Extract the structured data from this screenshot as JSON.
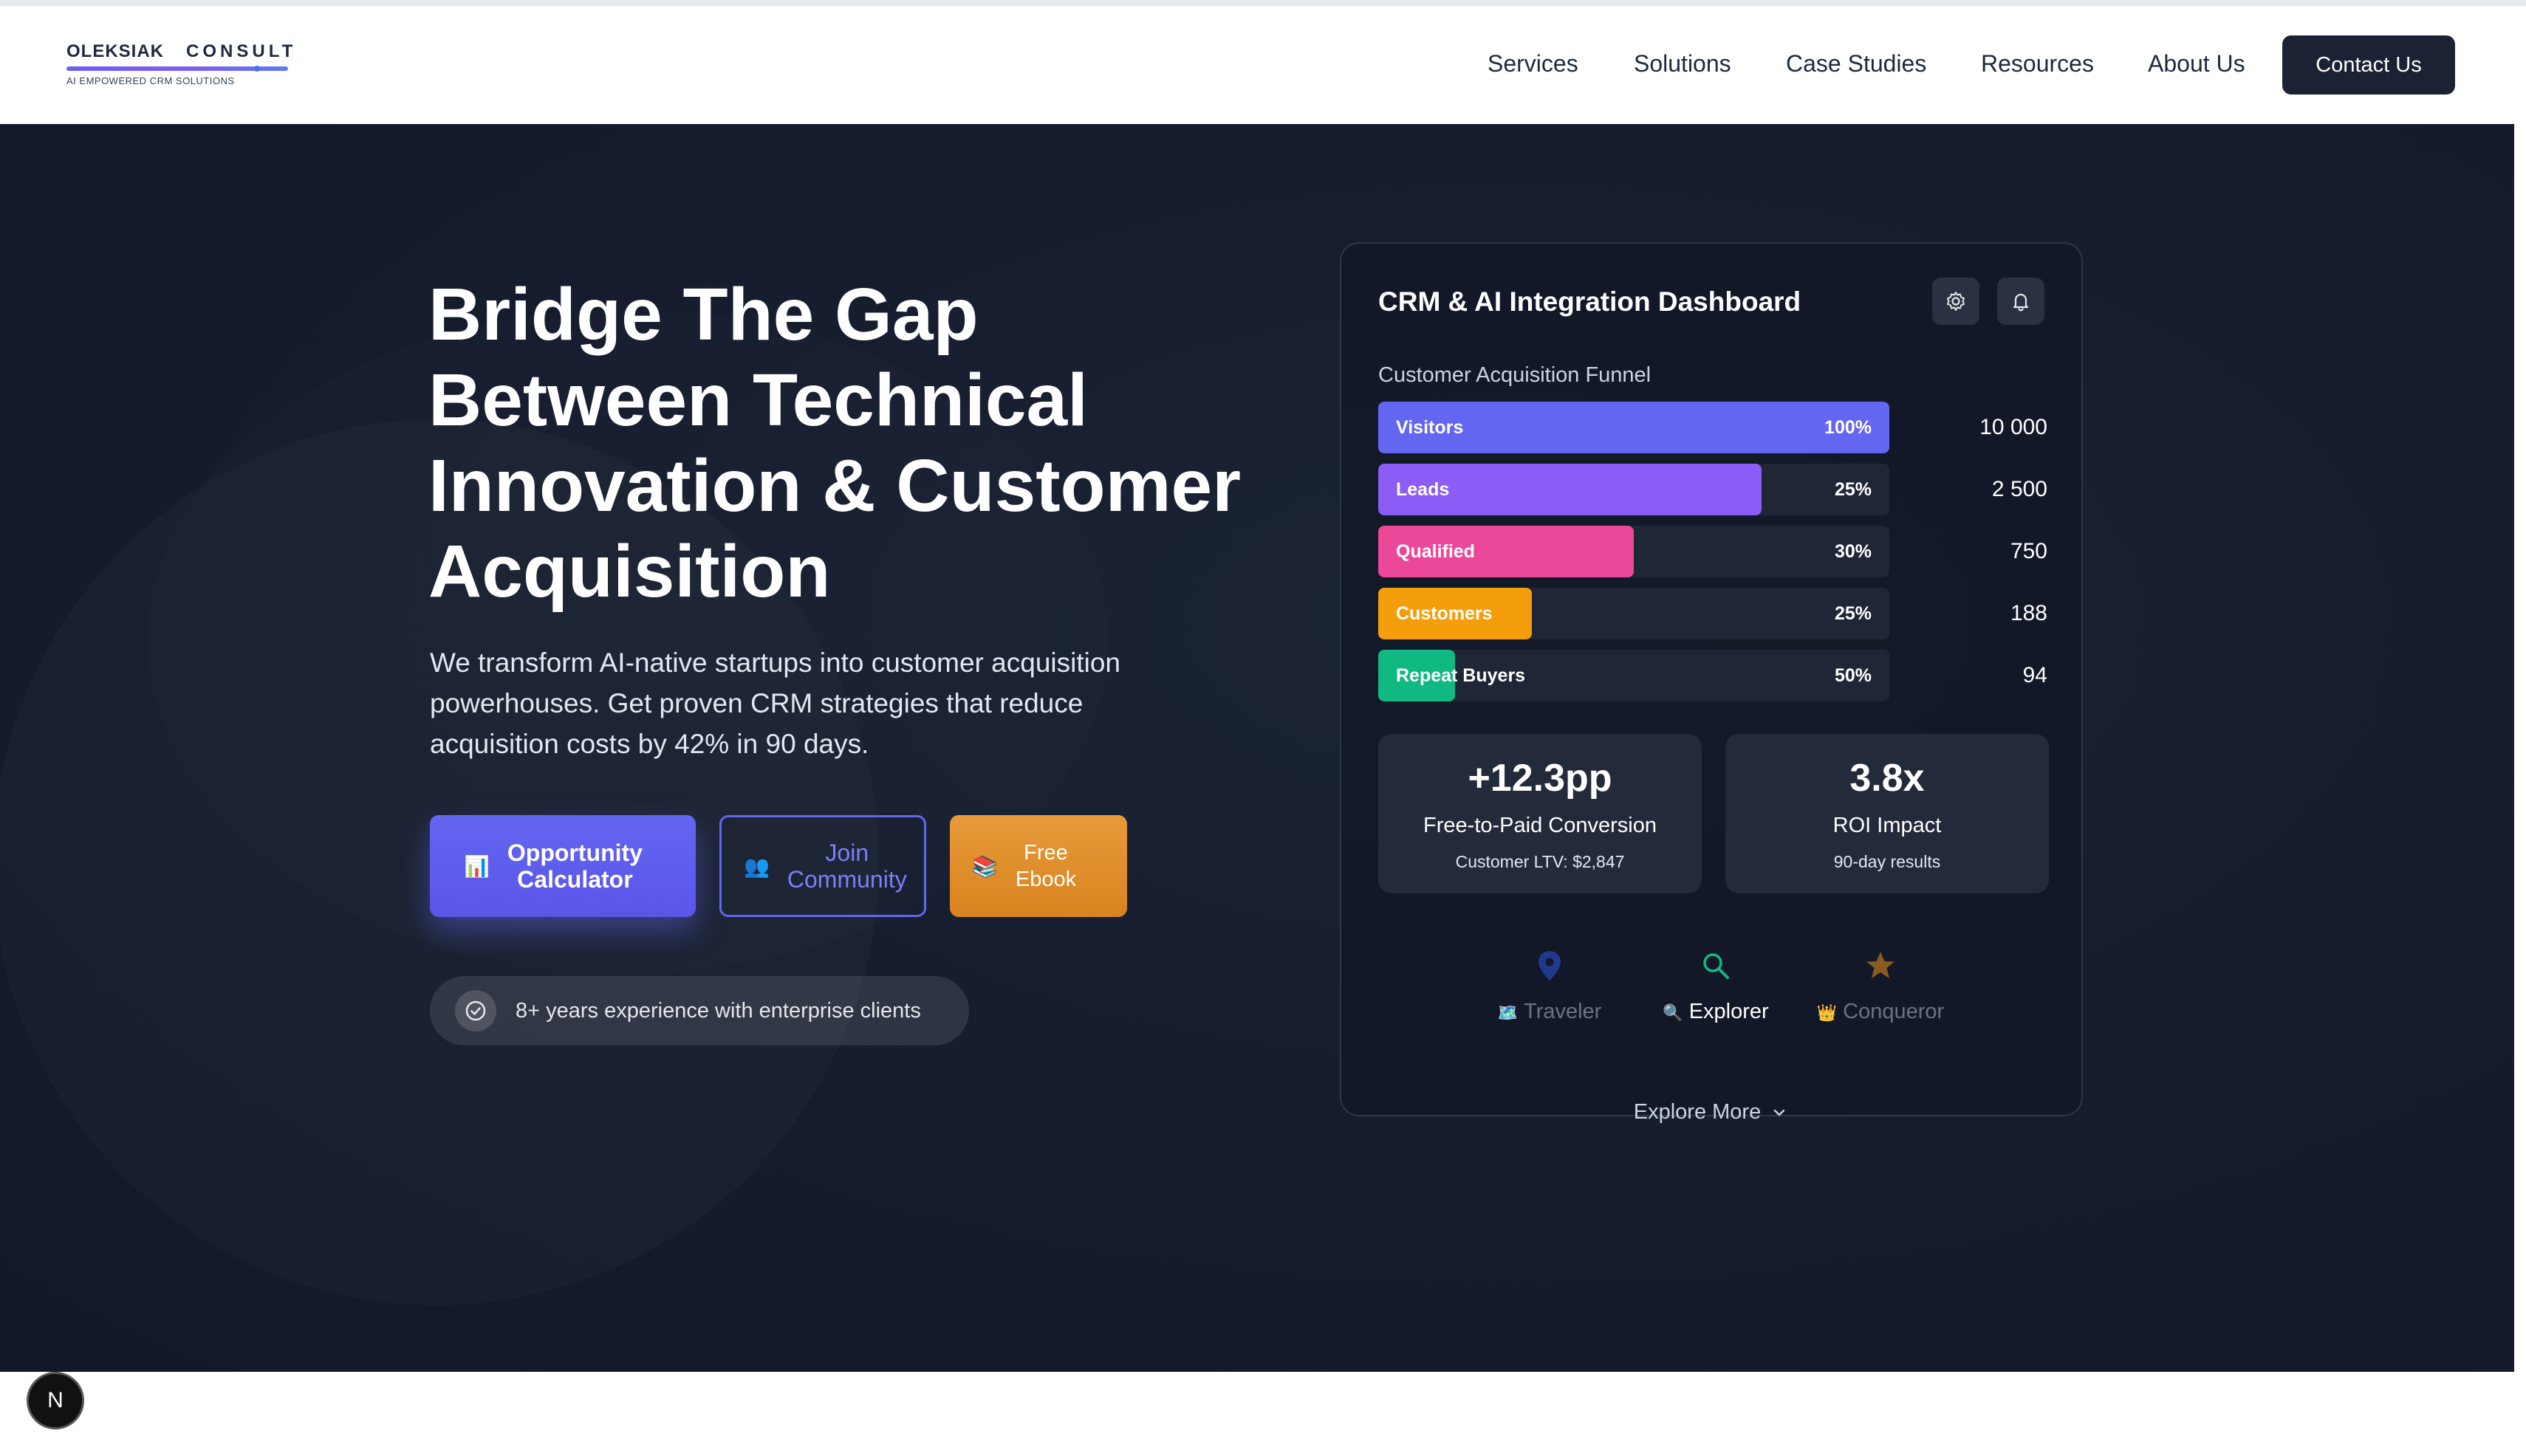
{
  "brand": {
    "name_part1": "OLEKSIAK",
    "name_part2": "CONSULT",
    "tagline": "AI EMPOWERED CRM SOLUTIONS"
  },
  "nav": {
    "items": [
      "Services",
      "Solutions",
      "Case Studies",
      "Resources",
      "About Us"
    ],
    "cta": "Contact Us"
  },
  "hero": {
    "headline_lines": [
      "Bridge The Gap",
      "Between Technical",
      "Innovation & Customer",
      "Acquisition"
    ],
    "subtext": "We transform AI-native startups into customer acquisition powerhouses. Get proven CRM strategies that reduce acquisition costs by 42% in 90 days.",
    "buttons": {
      "calculator": {
        "icon": "📊",
        "line1": "Opportunity",
        "line2": "Calculator"
      },
      "community": {
        "icon": "👥",
        "line1": "Join",
        "line2": "Community"
      },
      "ebook": {
        "icon": "📚",
        "line1": "Free",
        "line2": "Ebook"
      }
    },
    "experience": "8+ years experience with enterprise clients"
  },
  "dashboard": {
    "title": "CRM & AI Integration Dashboard",
    "icons": [
      "gear-icon",
      "bell-icon"
    ],
    "funnel": {
      "label": "Customer Acquisition Funnel",
      "rows": [
        {
          "name": "Visitors",
          "pct": "100%",
          "value": "10 000",
          "fill": 1.0,
          "color": "#6366f1"
        },
        {
          "name": "Leads",
          "pct": "25%",
          "value": "2 500",
          "fill": 0.75,
          "color": "#8b5cf6"
        },
        {
          "name": "Qualified",
          "pct": "30%",
          "value": "750",
          "fill": 0.5,
          "color": "#ec4899"
        },
        {
          "name": "Customers",
          "pct": "25%",
          "value": "188",
          "fill": 0.3,
          "color": "#f59e0b"
        },
        {
          "name": "Repeat Buyers",
          "pct": "50%",
          "value": "94",
          "fill": 0.15,
          "color": "#10b981"
        }
      ]
    },
    "stats": [
      {
        "value": "+12.3pp",
        "label": "Free-to-Paid Conversion",
        "sub": "Customer LTV: $2,847"
      },
      {
        "value": "3.8x",
        "label": "ROI Impact",
        "sub": "90-day results"
      }
    ],
    "achievements": [
      {
        "icon": "map-pin-icon",
        "prefix": "🗺️",
        "label": "Traveler",
        "active": false
      },
      {
        "icon": "search-icon",
        "prefix": "🔍",
        "label": "Explorer",
        "active": true
      },
      {
        "icon": "star-icon",
        "prefix": "👑",
        "label": "Conqueror",
        "active": false
      }
    ],
    "explore_more": "Explore More"
  },
  "badge": {
    "letter": "N"
  },
  "colors": {
    "accent": "#6366f1",
    "header_dark": "#1b2233",
    "hero_bg": "#161d2e",
    "ebook_orange": "#e08e2c"
  }
}
